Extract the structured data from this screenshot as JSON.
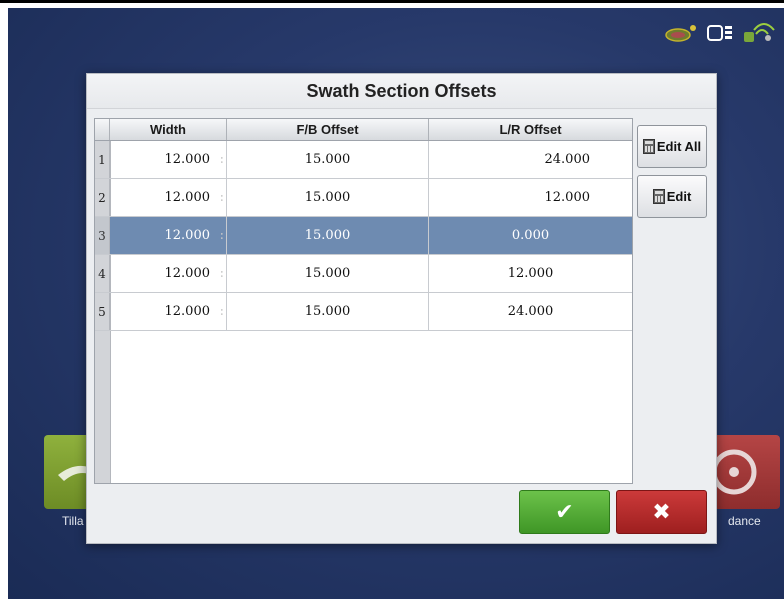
{
  "dialog": {
    "title": "Swath Section Offsets",
    "columns": [
      "Width",
      "F/B Offset",
      "L/R Offset"
    ],
    "rows": [
      {
        "num": "1",
        "width": "12.000",
        "fb": "15.000",
        "lr": "24.000"
      },
      {
        "num": "2",
        "width": "12.000",
        "fb": "15.000",
        "lr": "12.000"
      },
      {
        "num": "3",
        "width": "12.000",
        "fb": "15.000",
        "lr": "0.000"
      },
      {
        "num": "4",
        "width": "12.000",
        "fb": "15.000",
        "lr": "12.000"
      },
      {
        "num": "5",
        "width": "12.000",
        "fb": "15.000",
        "lr": "24.000"
      }
    ],
    "selected_row": 3,
    "edit_all_label": "Edit All",
    "edit_label": "Edit",
    "ok_icon": "checkmark-icon",
    "cancel_icon": "x-icon"
  },
  "background": {
    "left_tile_label": "Tilla",
    "right_tile_label": "dance"
  },
  "status_icons": [
    "gps-signal-icon",
    "module-icon",
    "wireless-icon"
  ],
  "colors": {
    "selection": "#6e8bb1",
    "ok": "#4fa832",
    "cancel": "#b12b2b",
    "background": "#27396a"
  }
}
